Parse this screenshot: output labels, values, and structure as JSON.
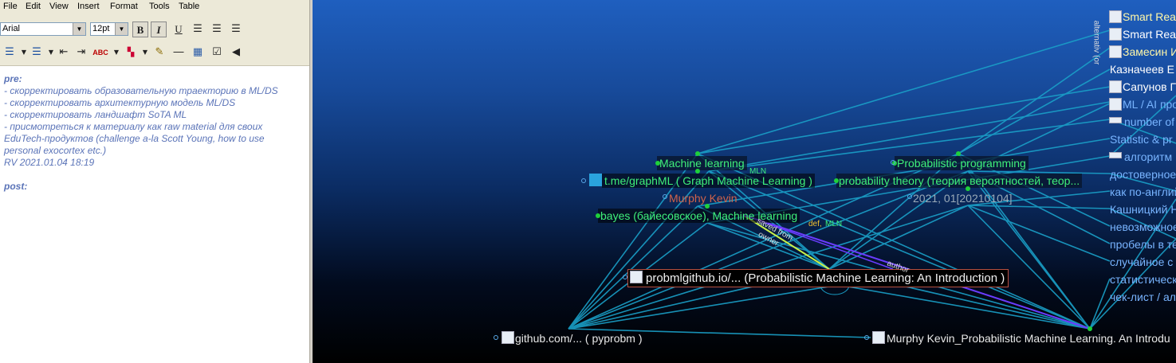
{
  "menu": [
    "File",
    "Edit",
    "View",
    "Insert",
    "Format",
    "Tools",
    "Table"
  ],
  "toolbar": {
    "font": "Arial",
    "size": "12pt",
    "bold": "B",
    "italic": "I",
    "underline": "U"
  },
  "editor": {
    "lines": [
      "pre:",
      "- скорректировать образовательную траекторию в ML/DS",
      "- скорректировать архитектурную модель ML/DS",
      "- скорректировать ландшафт SoTA ML",
      "- присмотреться к материалу как raw material для своих",
      "EduTech-продуктов (challenge a-la Scott Young, how to use",
      "personal exocortex etc.)",
      "RV 2021.01.04 18:19",
      "",
      "post:"
    ]
  },
  "graph": {
    "colors": {
      "link": "#1aa0c8",
      "node_text_green": "#3ff07a",
      "node_text_blue": "#78b4ff",
      "highlight": "#6a3cff"
    },
    "nodes": {
      "machine_learning": "Machine learning",
      "graph_ml": "t.me/graphML ( Graph Machine Learning )",
      "murphy": "Murphy Kevin",
      "bayes": "bayes (байесовское), Machine learning",
      "prob_programming": "Probabilistic programming",
      "prob_theory": "probability theory (теория вероятностей, теор...",
      "date": "2021, 01[20210104]",
      "central": "probmlgithub.io/... (Probabilistic Machine Learning: An Introduction )",
      "pyprobm": "github.com/... ( pyprobm )",
      "murphy_file": "Murphy Kevin_Probabilistic Machine Learning. An Introdu"
    },
    "edge_labels": {
      "mln1": "MLN",
      "def": "def,",
      "mln2": "MLN",
      "saved_from": "saved from",
      "owner": "owner",
      "author": "author",
      "alt": "alternativ (or"
    },
    "right_nodes": [
      "Smart Rea",
      "Smart Rea",
      "Замесин И",
      "Казначеев Е",
      "Сапунов Г",
      "ML / AI про",
      "number of",
      "Statistic & pr",
      "алгоритм (",
      "достоверное",
      "как по-англий",
      "Кашницкий Н",
      "невозможное",
      "пробелы в те",
      "случайное с",
      "статистическ",
      "чек-лист / ал"
    ]
  }
}
